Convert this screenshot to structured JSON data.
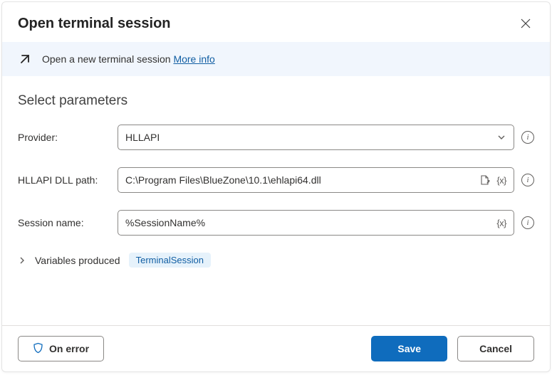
{
  "header": {
    "title": "Open terminal session"
  },
  "banner": {
    "text": "Open a new terminal session ",
    "link": "More info"
  },
  "section": {
    "title": "Select parameters"
  },
  "form": {
    "provider": {
      "label": "Provider:",
      "value": "HLLAPI"
    },
    "dll": {
      "label": "HLLAPI DLL path:",
      "value": "C:\\Program Files\\BlueZone\\10.1\\ehlapi64.dll"
    },
    "session": {
      "label": "Session name:",
      "value": "%SessionName%"
    }
  },
  "variables": {
    "label": "Variables produced",
    "chip": "TerminalSession"
  },
  "footer": {
    "error": "On error",
    "save": "Save",
    "cancel": "Cancel"
  }
}
